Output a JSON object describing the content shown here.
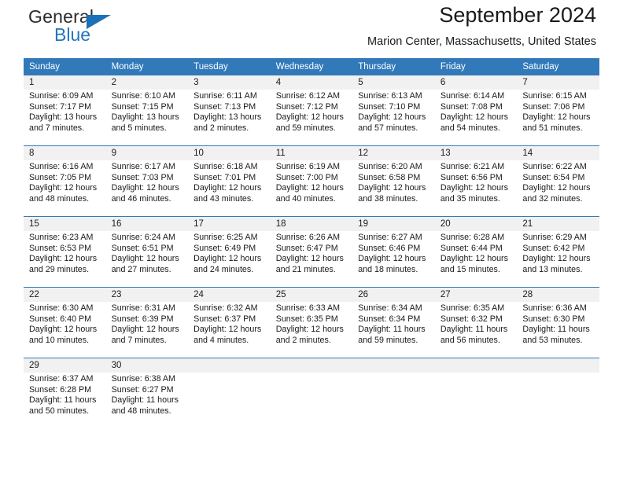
{
  "brand": {
    "name_part1": "General",
    "name_part2": "Blue",
    "triangle_color": "#1b71b8"
  },
  "header": {
    "title": "September 2024",
    "subtitle": "Marion Center, Massachusetts, United States"
  },
  "colors": {
    "header_blue": "#3179b9",
    "daynum_gray": "#f1f1f1",
    "text": "#1a1a1a"
  },
  "weekdays": [
    "Sunday",
    "Monday",
    "Tuesday",
    "Wednesday",
    "Thursday",
    "Friday",
    "Saturday"
  ],
  "weeks": [
    {
      "days": [
        {
          "num": "1",
          "sunrise": "Sunrise: 6:09 AM",
          "sunset": "Sunset: 7:17 PM",
          "daylight1": "Daylight: 13 hours",
          "daylight2": "and 7 minutes."
        },
        {
          "num": "2",
          "sunrise": "Sunrise: 6:10 AM",
          "sunset": "Sunset: 7:15 PM",
          "daylight1": "Daylight: 13 hours",
          "daylight2": "and 5 minutes."
        },
        {
          "num": "3",
          "sunrise": "Sunrise: 6:11 AM",
          "sunset": "Sunset: 7:13 PM",
          "daylight1": "Daylight: 13 hours",
          "daylight2": "and 2 minutes."
        },
        {
          "num": "4",
          "sunrise": "Sunrise: 6:12 AM",
          "sunset": "Sunset: 7:12 PM",
          "daylight1": "Daylight: 12 hours",
          "daylight2": "and 59 minutes."
        },
        {
          "num": "5",
          "sunrise": "Sunrise: 6:13 AM",
          "sunset": "Sunset: 7:10 PM",
          "daylight1": "Daylight: 12 hours",
          "daylight2": "and 57 minutes."
        },
        {
          "num": "6",
          "sunrise": "Sunrise: 6:14 AM",
          "sunset": "Sunset: 7:08 PM",
          "daylight1": "Daylight: 12 hours",
          "daylight2": "and 54 minutes."
        },
        {
          "num": "7",
          "sunrise": "Sunrise: 6:15 AM",
          "sunset": "Sunset: 7:06 PM",
          "daylight1": "Daylight: 12 hours",
          "daylight2": "and 51 minutes."
        }
      ]
    },
    {
      "days": [
        {
          "num": "8",
          "sunrise": "Sunrise: 6:16 AM",
          "sunset": "Sunset: 7:05 PM",
          "daylight1": "Daylight: 12 hours",
          "daylight2": "and 48 minutes."
        },
        {
          "num": "9",
          "sunrise": "Sunrise: 6:17 AM",
          "sunset": "Sunset: 7:03 PM",
          "daylight1": "Daylight: 12 hours",
          "daylight2": "and 46 minutes."
        },
        {
          "num": "10",
          "sunrise": "Sunrise: 6:18 AM",
          "sunset": "Sunset: 7:01 PM",
          "daylight1": "Daylight: 12 hours",
          "daylight2": "and 43 minutes."
        },
        {
          "num": "11",
          "sunrise": "Sunrise: 6:19 AM",
          "sunset": "Sunset: 7:00 PM",
          "daylight1": "Daylight: 12 hours",
          "daylight2": "and 40 minutes."
        },
        {
          "num": "12",
          "sunrise": "Sunrise: 6:20 AM",
          "sunset": "Sunset: 6:58 PM",
          "daylight1": "Daylight: 12 hours",
          "daylight2": "and 38 minutes."
        },
        {
          "num": "13",
          "sunrise": "Sunrise: 6:21 AM",
          "sunset": "Sunset: 6:56 PM",
          "daylight1": "Daylight: 12 hours",
          "daylight2": "and 35 minutes."
        },
        {
          "num": "14",
          "sunrise": "Sunrise: 6:22 AM",
          "sunset": "Sunset: 6:54 PM",
          "daylight1": "Daylight: 12 hours",
          "daylight2": "and 32 minutes."
        }
      ]
    },
    {
      "days": [
        {
          "num": "15",
          "sunrise": "Sunrise: 6:23 AM",
          "sunset": "Sunset: 6:53 PM",
          "daylight1": "Daylight: 12 hours",
          "daylight2": "and 29 minutes."
        },
        {
          "num": "16",
          "sunrise": "Sunrise: 6:24 AM",
          "sunset": "Sunset: 6:51 PM",
          "daylight1": "Daylight: 12 hours",
          "daylight2": "and 27 minutes."
        },
        {
          "num": "17",
          "sunrise": "Sunrise: 6:25 AM",
          "sunset": "Sunset: 6:49 PM",
          "daylight1": "Daylight: 12 hours",
          "daylight2": "and 24 minutes."
        },
        {
          "num": "18",
          "sunrise": "Sunrise: 6:26 AM",
          "sunset": "Sunset: 6:47 PM",
          "daylight1": "Daylight: 12 hours",
          "daylight2": "and 21 minutes."
        },
        {
          "num": "19",
          "sunrise": "Sunrise: 6:27 AM",
          "sunset": "Sunset: 6:46 PM",
          "daylight1": "Daylight: 12 hours",
          "daylight2": "and 18 minutes."
        },
        {
          "num": "20",
          "sunrise": "Sunrise: 6:28 AM",
          "sunset": "Sunset: 6:44 PM",
          "daylight1": "Daylight: 12 hours",
          "daylight2": "and 15 minutes."
        },
        {
          "num": "21",
          "sunrise": "Sunrise: 6:29 AM",
          "sunset": "Sunset: 6:42 PM",
          "daylight1": "Daylight: 12 hours",
          "daylight2": "and 13 minutes."
        }
      ]
    },
    {
      "days": [
        {
          "num": "22",
          "sunrise": "Sunrise: 6:30 AM",
          "sunset": "Sunset: 6:40 PM",
          "daylight1": "Daylight: 12 hours",
          "daylight2": "and 10 minutes."
        },
        {
          "num": "23",
          "sunrise": "Sunrise: 6:31 AM",
          "sunset": "Sunset: 6:39 PM",
          "daylight1": "Daylight: 12 hours",
          "daylight2": "and 7 minutes."
        },
        {
          "num": "24",
          "sunrise": "Sunrise: 6:32 AM",
          "sunset": "Sunset: 6:37 PM",
          "daylight1": "Daylight: 12 hours",
          "daylight2": "and 4 minutes."
        },
        {
          "num": "25",
          "sunrise": "Sunrise: 6:33 AM",
          "sunset": "Sunset: 6:35 PM",
          "daylight1": "Daylight: 12 hours",
          "daylight2": "and 2 minutes."
        },
        {
          "num": "26",
          "sunrise": "Sunrise: 6:34 AM",
          "sunset": "Sunset: 6:34 PM",
          "daylight1": "Daylight: 11 hours",
          "daylight2": "and 59 minutes."
        },
        {
          "num": "27",
          "sunrise": "Sunrise: 6:35 AM",
          "sunset": "Sunset: 6:32 PM",
          "daylight1": "Daylight: 11 hours",
          "daylight2": "and 56 minutes."
        },
        {
          "num": "28",
          "sunrise": "Sunrise: 6:36 AM",
          "sunset": "Sunset: 6:30 PM",
          "daylight1": "Daylight: 11 hours",
          "daylight2": "and 53 minutes."
        }
      ]
    },
    {
      "days": [
        {
          "num": "29",
          "sunrise": "Sunrise: 6:37 AM",
          "sunset": "Sunset: 6:28 PM",
          "daylight1": "Daylight: 11 hours",
          "daylight2": "and 50 minutes."
        },
        {
          "num": "30",
          "sunrise": "Sunrise: 6:38 AM",
          "sunset": "Sunset: 6:27 PM",
          "daylight1": "Daylight: 11 hours",
          "daylight2": "and 48 minutes."
        },
        {
          "num": "",
          "sunrise": "",
          "sunset": "",
          "daylight1": "",
          "daylight2": ""
        },
        {
          "num": "",
          "sunrise": "",
          "sunset": "",
          "daylight1": "",
          "daylight2": ""
        },
        {
          "num": "",
          "sunrise": "",
          "sunset": "",
          "daylight1": "",
          "daylight2": ""
        },
        {
          "num": "",
          "sunrise": "",
          "sunset": "",
          "daylight1": "",
          "daylight2": ""
        },
        {
          "num": "",
          "sunrise": "",
          "sunset": "",
          "daylight1": "",
          "daylight2": ""
        }
      ]
    }
  ]
}
